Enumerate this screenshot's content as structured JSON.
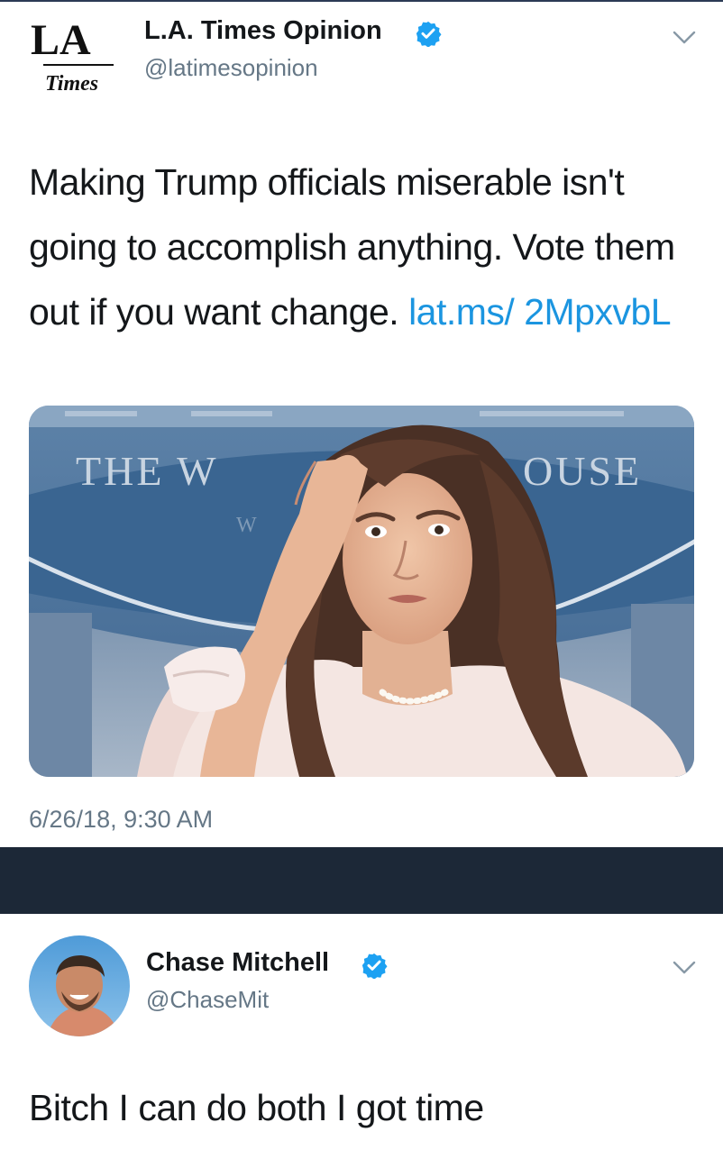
{
  "tweet1": {
    "logo_text_top": "LA",
    "logo_text_bottom": "Times",
    "display_name": "L.A. Times Opinion",
    "handle": "@latimesopinion",
    "text_before_link": "Making Trump officials miserable isn't going to accomplish anything. Vote them out if you want change. ",
    "link_text": "lat.ms/ 2MpxvbL",
    "media": {
      "backdrop_text_left": "THE W",
      "backdrop_text_right": "OUSE",
      "backdrop_text_small": "W"
    },
    "timestamp": "6/26/18, 9:30 AM"
  },
  "tweet2": {
    "display_name": "Chase Mitchell",
    "handle": "@ChaseMit",
    "text": "Bitch I can do both I got time"
  },
  "colors": {
    "link": "#1b95e0",
    "verified": "#1da1f2",
    "secondary_text": "#657786",
    "divider_band": "#1c2837"
  },
  "icons": {
    "verified": "verified-badge-icon",
    "chevron": "chevron-down-icon"
  }
}
